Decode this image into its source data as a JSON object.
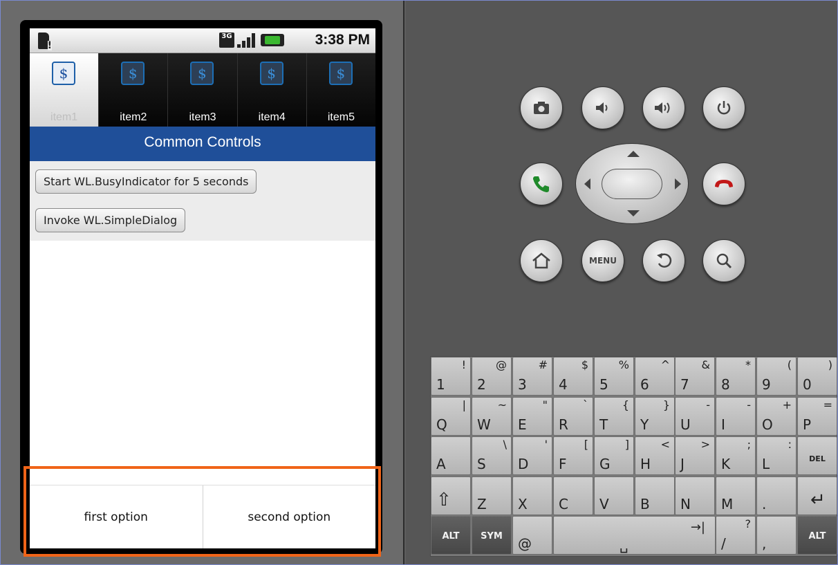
{
  "status_bar": {
    "network_badge": "3G",
    "time": "3:38 PM",
    "icons": [
      "sd-card-alert-icon",
      "network-3g-icon",
      "signal-strength-icon",
      "battery-charging-icon"
    ]
  },
  "tabs": [
    {
      "label": "item1",
      "icon": "dollar-icon",
      "active": true
    },
    {
      "label": "item2",
      "icon": "dollar-icon",
      "active": false
    },
    {
      "label": "item3",
      "icon": "dollar-icon",
      "active": false
    },
    {
      "label": "item4",
      "icon": "dollar-icon",
      "active": false
    },
    {
      "label": "item5",
      "icon": "dollar-icon",
      "active": false
    }
  ],
  "tab_icon_glyph": "$",
  "page": {
    "title": "Common Controls",
    "buttons": [
      {
        "label": "Start WL.BusyIndicator for 5 seconds"
      },
      {
        "label": "Invoke WL.SimpleDialog"
      }
    ]
  },
  "options_bar": {
    "options": [
      {
        "label": "first option"
      },
      {
        "label": "second option"
      }
    ]
  },
  "hardware_buttons": {
    "row1": [
      "camera-icon",
      "volume-down-icon",
      "volume-up-icon",
      "power-icon"
    ],
    "row2": [
      "call-icon",
      "dpad",
      "end-call-icon"
    ],
    "row3": [
      "home-icon",
      "menu-button",
      "back-icon",
      "search-icon"
    ],
    "menu_label": "MENU"
  },
  "keyboard": {
    "rows": [
      [
        {
          "main": "1",
          "alt": "!"
        },
        {
          "main": "2",
          "alt": "@"
        },
        {
          "main": "3",
          "alt": "#"
        },
        {
          "main": "4",
          "alt": "$"
        },
        {
          "main": "5",
          "alt": "%"
        },
        {
          "main": "6",
          "alt": "^"
        },
        {
          "main": "7",
          "alt": "&"
        },
        {
          "main": "8",
          "alt": "*"
        },
        {
          "main": "9",
          "alt": "("
        },
        {
          "main": "0",
          "alt": ")"
        }
      ],
      [
        {
          "main": "Q",
          "alt": "|"
        },
        {
          "main": "W",
          "alt": "~"
        },
        {
          "main": "E",
          "alt": "\""
        },
        {
          "main": "R",
          "alt": "`"
        },
        {
          "main": "T",
          "alt": "{"
        },
        {
          "main": "Y",
          "alt": "}"
        },
        {
          "main": "U",
          "alt": "-"
        },
        {
          "main": "I",
          "alt": "-"
        },
        {
          "main": "O",
          "alt": "+"
        },
        {
          "main": "P",
          "alt": "="
        }
      ],
      [
        {
          "main": "A",
          "alt": ""
        },
        {
          "main": "S",
          "alt": "\\"
        },
        {
          "main": "D",
          "alt": "'"
        },
        {
          "main": "F",
          "alt": "["
        },
        {
          "main": "G",
          "alt": "]"
        },
        {
          "main": "H",
          "alt": "<"
        },
        {
          "main": "J",
          "alt": ">"
        },
        {
          "main": "K",
          "alt": ";"
        },
        {
          "main": "L",
          "alt": ":"
        },
        {
          "main": "DEL",
          "alt": "",
          "kind": "del"
        }
      ],
      [
        {
          "main": "⇧",
          "alt": "",
          "kind": "shift"
        },
        {
          "main": "Z",
          "alt": ""
        },
        {
          "main": "X",
          "alt": ""
        },
        {
          "main": "C",
          "alt": ""
        },
        {
          "main": "V",
          "alt": ""
        },
        {
          "main": "B",
          "alt": ""
        },
        {
          "main": "N",
          "alt": ""
        },
        {
          "main": "M",
          "alt": ""
        },
        {
          "main": ".",
          "alt": ""
        },
        {
          "main": "↵",
          "alt": "",
          "kind": "enter"
        }
      ],
      [
        {
          "main": "ALT",
          "alt": "",
          "kind": "dark"
        },
        {
          "main": "SYM",
          "alt": "",
          "kind": "dark"
        },
        {
          "main": "@",
          "alt": ""
        },
        {
          "main": "␣",
          "alt": "→|",
          "kind": "space"
        },
        {
          "main": "/",
          "alt": "?"
        },
        {
          "main": ",",
          "alt": ""
        },
        {
          "main": "ALT",
          "alt": "",
          "kind": "dark"
        }
      ]
    ]
  },
  "colors": {
    "title_bar": "#1f4f99",
    "highlight_border": "#f06418",
    "tab_icon_border": "#1d6fb6",
    "call_green": "#1f8a2a",
    "end_call_red": "#c21818"
  }
}
